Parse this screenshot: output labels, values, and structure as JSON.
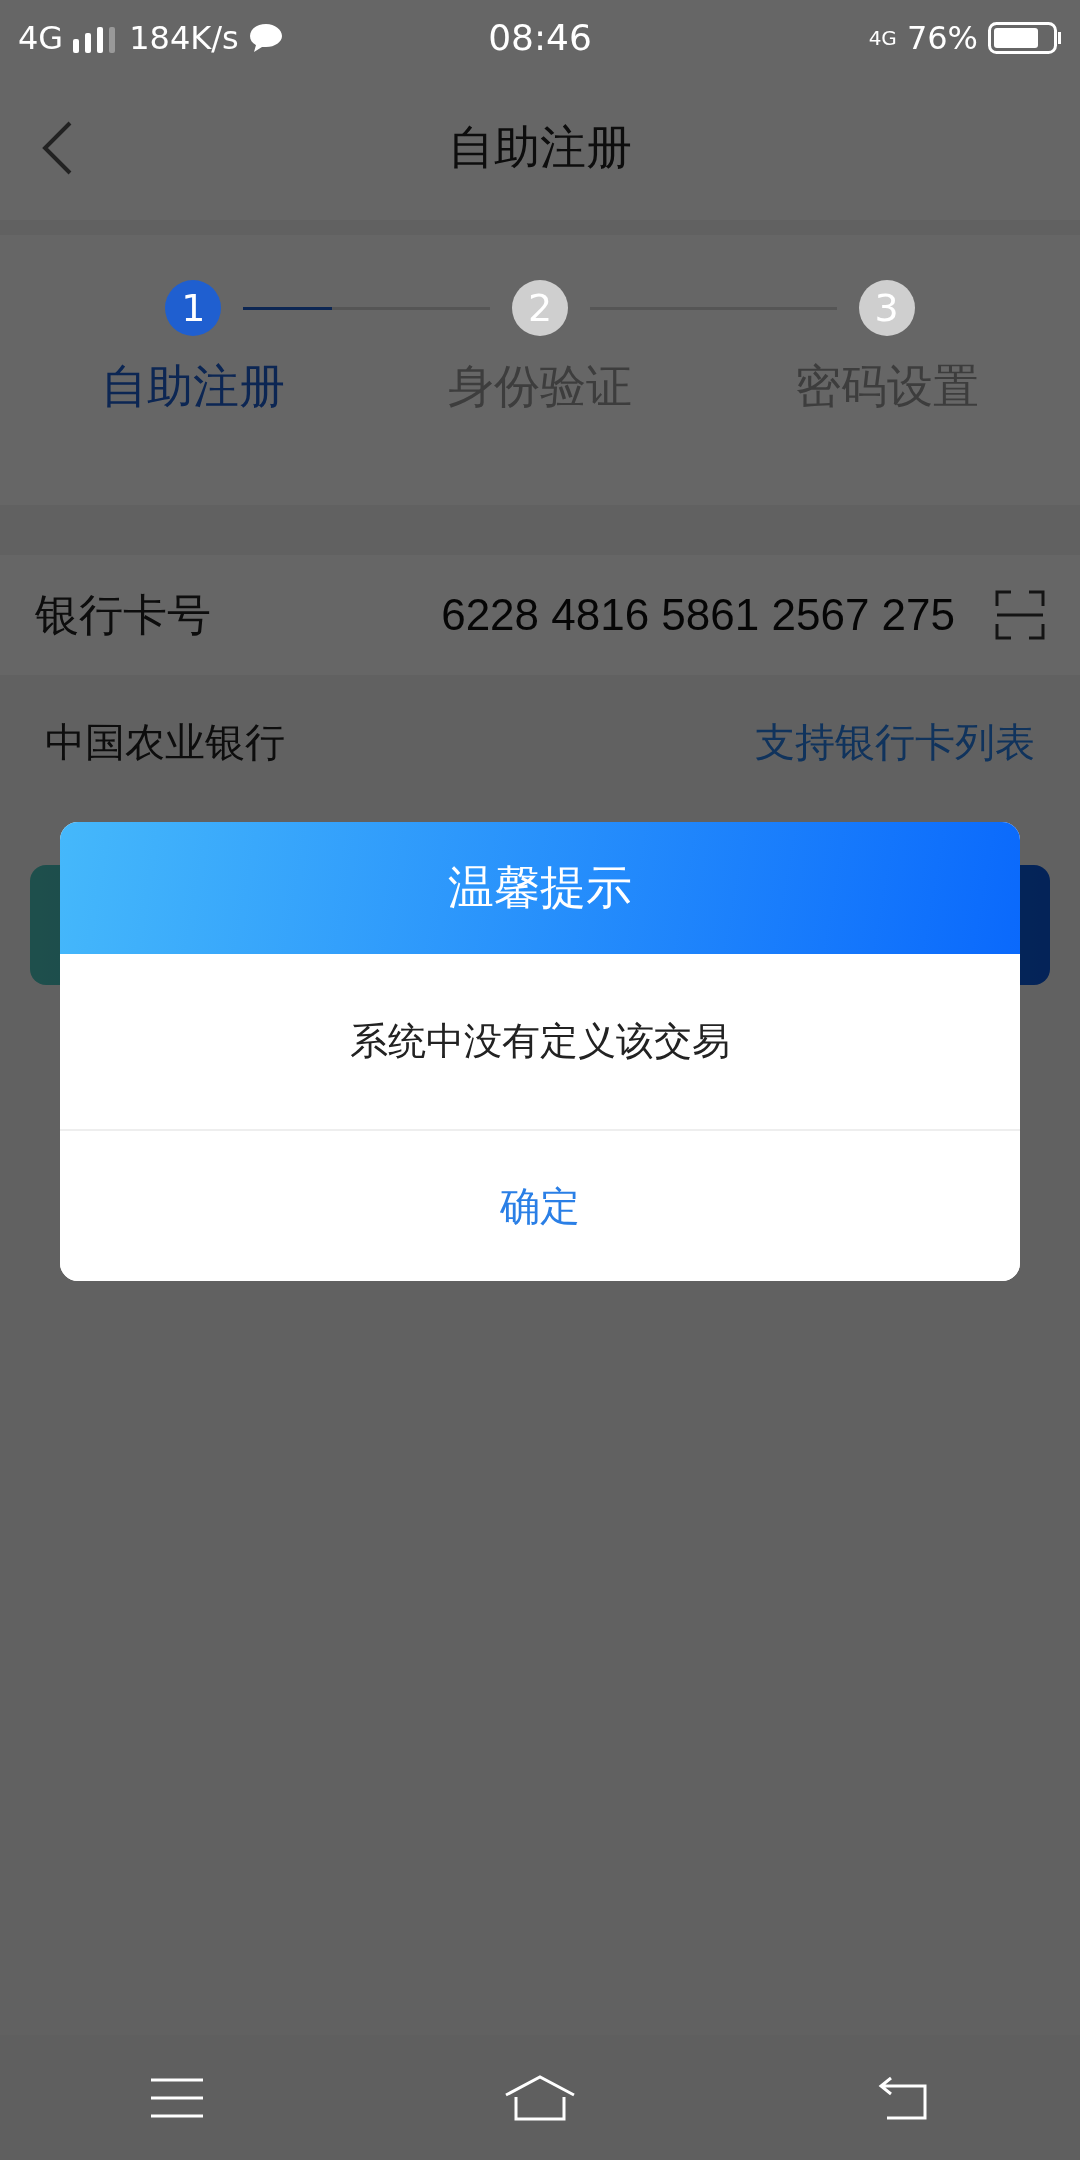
{
  "status_bar": {
    "network": "4G",
    "speed": "184K/s",
    "time": "08:46",
    "data_type": "4G",
    "battery": "76%"
  },
  "header": {
    "title": "自助注册"
  },
  "steps": [
    {
      "number": "1",
      "label": "自助注册",
      "selected": true
    },
    {
      "number": "2",
      "label": "身份验证",
      "selected": false
    },
    {
      "number": "3",
      "label": "密码设置",
      "selected": false
    }
  ],
  "card": {
    "label": "银行卡号",
    "value": "6228 4816 5861 2567 275"
  },
  "bank": {
    "name": "中国农业银行",
    "link": "支持银行卡列表"
  },
  "dialog": {
    "title": "温馨提示",
    "message": "系统中没有定义该交易",
    "confirm": "确定"
  }
}
